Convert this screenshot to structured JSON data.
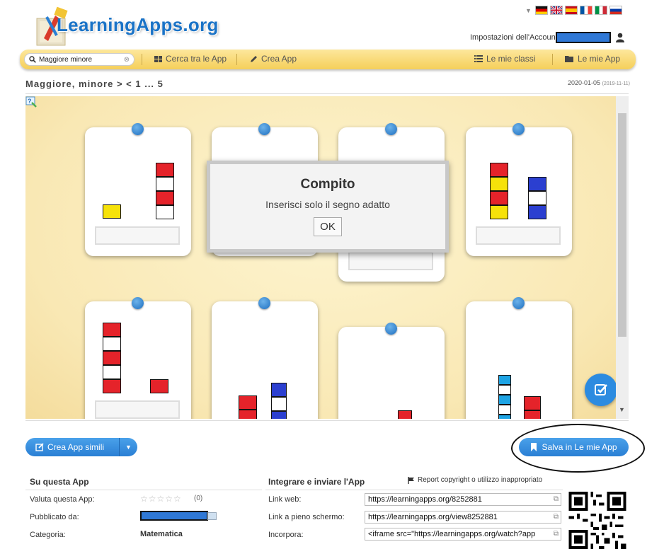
{
  "header": {
    "logo_text": "LearningApps.org",
    "account_label": "Impostazioni dell'Accoun",
    "flags": [
      "german-flag",
      "uk-flag",
      "spanish-flag",
      "french-flag",
      "italian-flag",
      "russian-flag"
    ]
  },
  "nav": {
    "search_value": "Maggiore minore",
    "items": [
      {
        "label": "Cerca tra le App",
        "icon": "grid-icon"
      },
      {
        "label": "Crea App",
        "icon": "pencil-icon"
      },
      {
        "label": "Le mie classi",
        "icon": "list-icon"
      },
      {
        "label": "Le mie App",
        "icon": "folder-icon"
      }
    ]
  },
  "page": {
    "breadcrumb": "Maggiore, minore > < 1 ... 5",
    "date": "2020-01-05",
    "date_created": "(2019-11-11)"
  },
  "modal": {
    "title": "Compito",
    "message": "Inserisci solo il segno adatto",
    "ok_label": "OK"
  },
  "actions": {
    "simili_label": "Crea App simili",
    "salva_label": "Salva in Le mie App"
  },
  "about": {
    "title": "Su questa App",
    "rate_label": "Valuta questa App:",
    "rate_count": "(0)",
    "published_label": "Pubblicato da:",
    "category_label": "Categoria:",
    "category_value": "Matematica"
  },
  "share": {
    "title": "Integrare e inviare l'App",
    "report_label": "Report copyright o utilizzo inappropriato",
    "web_label": "Link web:",
    "web_value": "https://learningapps.org/8252881",
    "full_label": "Link a pieno schermo:",
    "full_value": "https://learningapps.org/view8252881",
    "embed_label": "Incorpora:",
    "embed_value": "<iframe src=\"https://learningapps.org/watch?app"
  },
  "colors": {
    "accent": "#2a7fd4",
    "nav": "#f5cf5a",
    "board": "#f9e8b4"
  }
}
